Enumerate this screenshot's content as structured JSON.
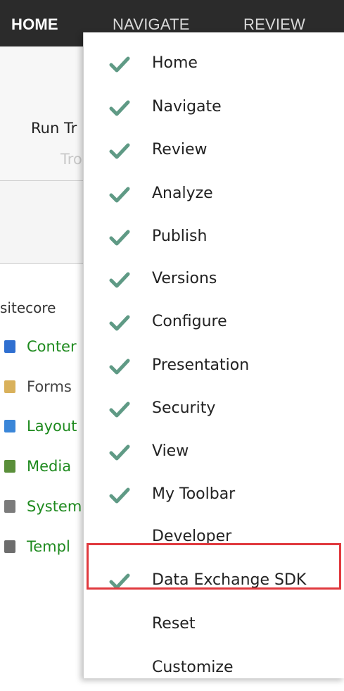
{
  "ribbon": {
    "tabs": [
      "HOME",
      "NAVIGATE",
      "REVIEW"
    ],
    "run_label": "Run Tr",
    "run_group": "Tro"
  },
  "tree": {
    "root": "sitecore",
    "items": [
      {
        "label": "Conter",
        "icon": "content-icon",
        "color": "#2f6fd0",
        "green": true
      },
      {
        "label": "Forms",
        "icon": "forms-icon",
        "color": "#d9b15b",
        "green": false
      },
      {
        "label": "Layout",
        "icon": "layout-icon",
        "color": "#3a86d8",
        "green": true
      },
      {
        "label": "Media",
        "icon": "media-icon",
        "color": "#5a8f3a",
        "green": true
      },
      {
        "label": "System",
        "icon": "system-icon",
        "color": "#7b7b7b",
        "green": true
      },
      {
        "label": "Templ",
        "icon": "templates-icon",
        "color": "#6d6d6d",
        "green": true
      }
    ]
  },
  "menu": {
    "check_color": "#5f9a85",
    "highlight_color": "#e0393e",
    "items": [
      {
        "label": "Home",
        "checked": true
      },
      {
        "label": "Navigate",
        "checked": true
      },
      {
        "label": "Review",
        "checked": true
      },
      {
        "label": "Analyze",
        "checked": true
      },
      {
        "label": "Publish",
        "checked": true
      },
      {
        "label": "Versions",
        "checked": true
      },
      {
        "label": "Configure",
        "checked": true
      },
      {
        "label": "Presentation",
        "checked": true
      },
      {
        "label": "Security",
        "checked": true
      },
      {
        "label": "View",
        "checked": true
      },
      {
        "label": "My Toolbar",
        "checked": true
      },
      {
        "label": "Developer",
        "checked": false
      },
      {
        "label": "Data Exchange SDK",
        "checked": true,
        "highlighted": true
      },
      {
        "label": "Reset",
        "checked": false
      },
      {
        "label": "Customize",
        "checked": false
      }
    ]
  }
}
